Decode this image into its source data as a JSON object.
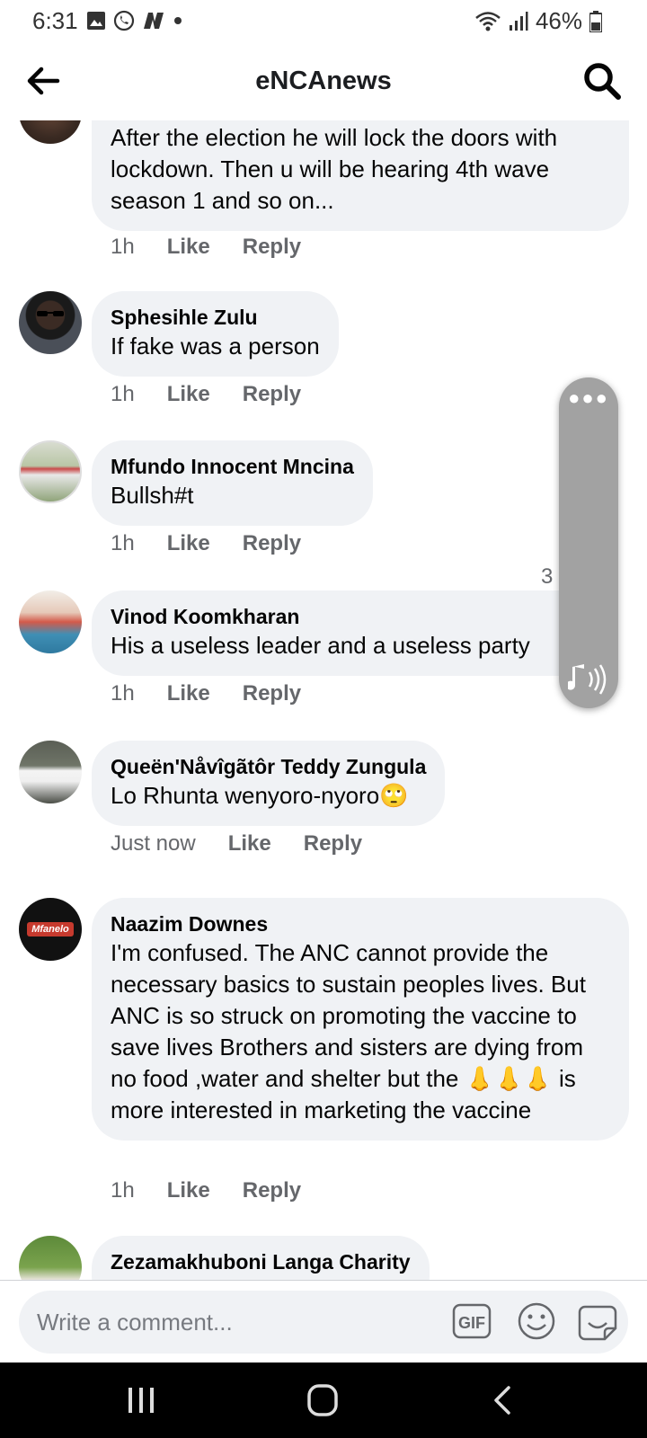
{
  "status_bar": {
    "time": "6:31",
    "battery": "46%",
    "left_icons": [
      "gallery-icon",
      "whatsapp-icon",
      "n-icon",
      "dot-icon"
    ],
    "right_icons": [
      "wifi-icon",
      "signal-icon",
      "battery-icon"
    ]
  },
  "app_bar": {
    "title": "eNCAnews"
  },
  "comments": [
    {
      "author": "",
      "text": "After the election he will lock the doors with lockdown. Then u will be hearing 4th wave season 1 and so on...",
      "time": "1h",
      "like": "Like",
      "reply": "Reply"
    },
    {
      "author": "Sphesihle Zulu",
      "text": "If fake was a person",
      "time": "1h",
      "like": "Like",
      "reply": "Reply"
    },
    {
      "author": "Mfundo Innocent Mncina",
      "text": "Bullsh#t",
      "time": "1h",
      "like": "Like",
      "reply": "Reply"
    },
    {
      "author": "Vinod Koomkharan",
      "text": "His a useless leader  and a useless party",
      "time": "1h",
      "like": "Like",
      "reply": "Reply",
      "reaction_count": "3"
    },
    {
      "author": "Queën'Nåvîgãtôr Teddy Zungula",
      "text": "Lo Rhunta wenyoro-nyoro🙄",
      "time": "Just now",
      "like": "Like",
      "reply": "Reply"
    },
    {
      "author": "Naazim Downes",
      "text": "I'm confused. The ANC cannot provide the necessary basics to sustain  peoples lives. But ANC is so struck on promoting the vaccine to save lives  Brothers and sisters are dying from no food ,water and shelter but the 👃👃👃 is more interested in marketing the vaccine",
      "time": "1h",
      "like": "Like",
      "reply": "Reply",
      "avatar_text": "Mfanelo"
    },
    {
      "author": "Zezamakhuboni Langa Charity",
      "text": ""
    }
  ],
  "composer": {
    "placeholder": "Write a comment..."
  },
  "colors": {
    "bubble": "#f0f2f5",
    "secondary_text": "#65676b",
    "reaction_blue": "#1877f2"
  }
}
